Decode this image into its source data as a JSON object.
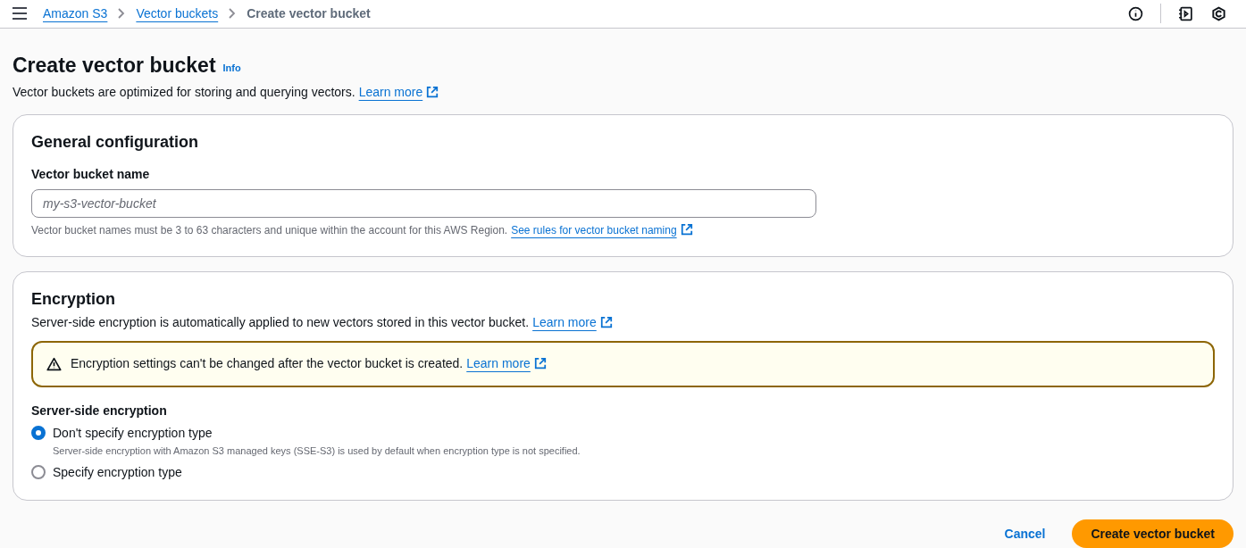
{
  "breadcrumbs": [
    {
      "label": "Amazon S3",
      "kind": "link"
    },
    {
      "label": "Vector buckets",
      "kind": "link"
    },
    {
      "label": "Create vector bucket",
      "kind": "current"
    }
  ],
  "page": {
    "title": "Create vector bucket",
    "info": "Info",
    "description": "Vector buckets are optimized for storing and querying vectors.",
    "learn_more": "Learn more"
  },
  "general": {
    "title": "General configuration",
    "field_label": "Vector bucket name",
    "placeholder": "my-s3-vector-bucket",
    "hint": "Vector bucket names must be 3 to 63 characters and unique within the account for this AWS Region.",
    "hint_link": "See rules for vector bucket naming"
  },
  "encryption": {
    "title": "Encryption",
    "description": "Server-side encryption is automatically applied to new vectors stored in this vector bucket.",
    "learn_more": "Learn more",
    "warning": "Encryption settings can't be changed after the vector bucket is created.",
    "warning_link": "Learn more",
    "group_label": "Server-side encryption",
    "options": [
      {
        "label": "Don't specify encryption type",
        "description": "Server-side encryption with Amazon S3 managed keys (SSE-S3) is used by default when encryption type is not specified.",
        "selected": true
      },
      {
        "label": "Specify encryption type",
        "selected": false
      }
    ]
  },
  "actions": {
    "cancel": "Cancel",
    "submit": "Create vector bucket"
  }
}
